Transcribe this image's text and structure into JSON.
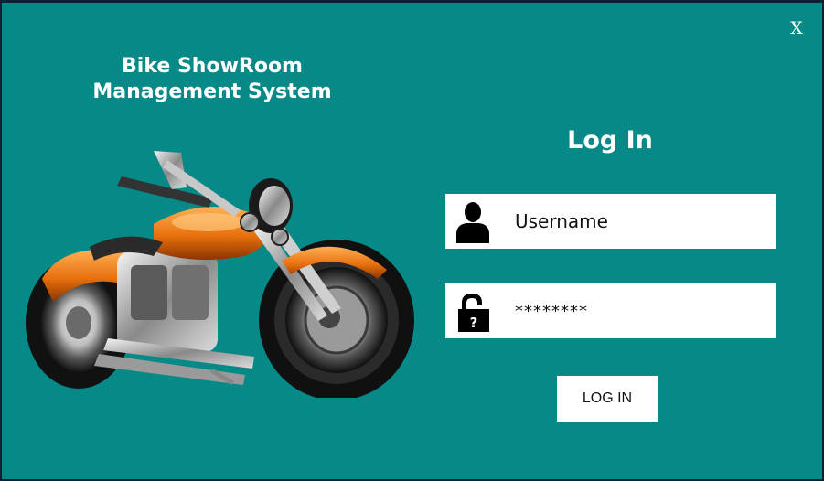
{
  "window": {
    "close_label": "X",
    "title_line1": "Bike ShowRoom",
    "title_line2": "Management System",
    "background_color": "#078a87"
  },
  "image": {
    "icon": "motorcycle-illustration"
  },
  "login": {
    "heading": "Log In",
    "username": {
      "icon": "user-icon",
      "placeholder": "Username",
      "value": ""
    },
    "password": {
      "icon": "padlock-icon",
      "value": "********"
    },
    "button_label": "LOG IN"
  }
}
